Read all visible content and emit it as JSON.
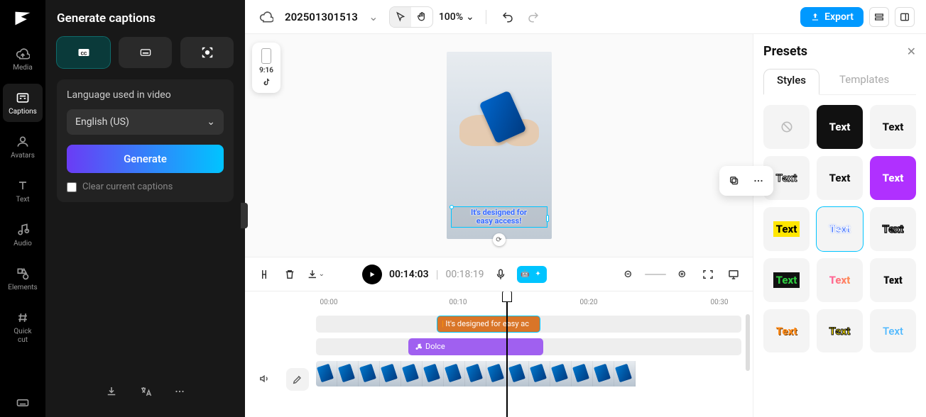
{
  "rail": {
    "media": "Media",
    "captions": "Captions",
    "avatars": "Avatars",
    "text": "Text",
    "audio": "Audio",
    "elements": "Elements",
    "quickcut": "Quick\ncut"
  },
  "panel": {
    "title": "Generate captions",
    "lang_label": "Language used in video",
    "lang_value": "English (US)",
    "generate": "Generate",
    "clear": "Clear current captions"
  },
  "topbar": {
    "project": "202501301513",
    "zoom": "100%",
    "export": "Export"
  },
  "canvas": {
    "ratio": "9:16",
    "caption_l1": "It's designed for",
    "caption_l2": "easy access!"
  },
  "player": {
    "current": "00:14:03",
    "duration": "00:18:19"
  },
  "timeline": {
    "ticks": [
      "00:00",
      "00:10",
      "00:20",
      "00:30"
    ],
    "caption_clip": "It's designed for easy ac",
    "audio_clip": "Dolce"
  },
  "presets": {
    "title": "Presets",
    "tabs": {
      "styles": "Styles",
      "templates": "Templates"
    },
    "item_label": "Text"
  }
}
